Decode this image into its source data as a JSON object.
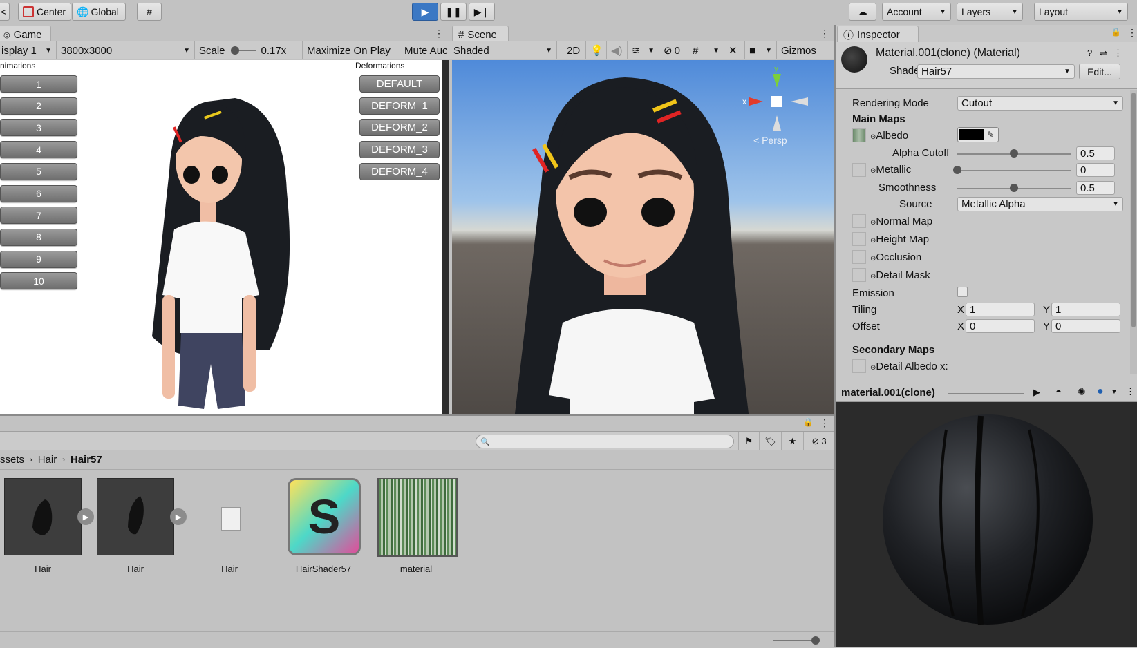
{
  "toolbar": {
    "center": "Center",
    "global": "Global",
    "account": "Account",
    "layers": "Layers",
    "layout": "Layout"
  },
  "game": {
    "tab": "Game",
    "display": "isplay 1",
    "resolution": "3800x3000",
    "scale_label": "Scale",
    "scale_value": "0.17x",
    "maximize": "Maximize On Play",
    "mute": "Mute Auc",
    "animations_title": "nimations",
    "deformations_title": "Deformations",
    "anim_buttons": [
      "1",
      "2",
      "3",
      "4",
      "5",
      "6",
      "7",
      "8",
      "9",
      "10"
    ],
    "deform_buttons": [
      "DEFAULT",
      "DEFORM_1",
      "DEFORM_2",
      "DEFORM_3",
      "DEFORM_4"
    ]
  },
  "scene": {
    "tab": "Scene",
    "shading": "Shaded",
    "mode2d": "2D",
    "hidden_count": "0",
    "gizmos": "Gizmos",
    "persp": "< Persp",
    "axis_x": "x",
    "axis_y": "y"
  },
  "inspector": {
    "tab": "Inspector",
    "title": "Material.001(clone) (Material)",
    "shader_label": "Shader",
    "shader_value": "Hair57",
    "edit": "Edit...",
    "rendering_mode_label": "Rendering Mode",
    "rendering_mode_value": "Cutout",
    "main_maps": "Main Maps",
    "albedo": "Albedo",
    "alpha_cutoff": "Alpha Cutoff",
    "alpha_cutoff_value": "0.5",
    "metallic": "Metallic",
    "metallic_value": "0",
    "smoothness": "Smoothness",
    "smoothness_value": "0.5",
    "source_label": "Source",
    "source_value": "Metallic Alpha",
    "normal_map": "Normal Map",
    "height_map": "Height Map",
    "occlusion": "Occlusion",
    "detail_mask": "Detail Mask",
    "emission": "Emission",
    "tiling": "Tiling",
    "offset": "Offset",
    "x": "X",
    "y": "Y",
    "tiling_x": "1",
    "tiling_y": "1",
    "offset_x": "0",
    "offset_y": "0",
    "secondary_maps": "Secondary Maps",
    "detail_albedo": "Detail Albedo x:",
    "alpha_cutoff_level": 0.5,
    "metallic_level": 0,
    "smoothness_level": 0.5
  },
  "preview": {
    "title": "material.001(clone)"
  },
  "project": {
    "breadcrumb": [
      "ssets",
      "Hair",
      "Hair57"
    ],
    "search_placeholder": "",
    "hidden_count": "3",
    "assets": [
      {
        "name": "Hair",
        "type": "prefab"
      },
      {
        "name": "Hair",
        "type": "prefab"
      },
      {
        "name": "Hair",
        "type": "file"
      },
      {
        "name": "HairShader57",
        "type": "shader"
      },
      {
        "name": "material",
        "type": "texture"
      }
    ]
  },
  "colors": {
    "play_active": "#3b78c4",
    "albedo_color": "#000000"
  }
}
